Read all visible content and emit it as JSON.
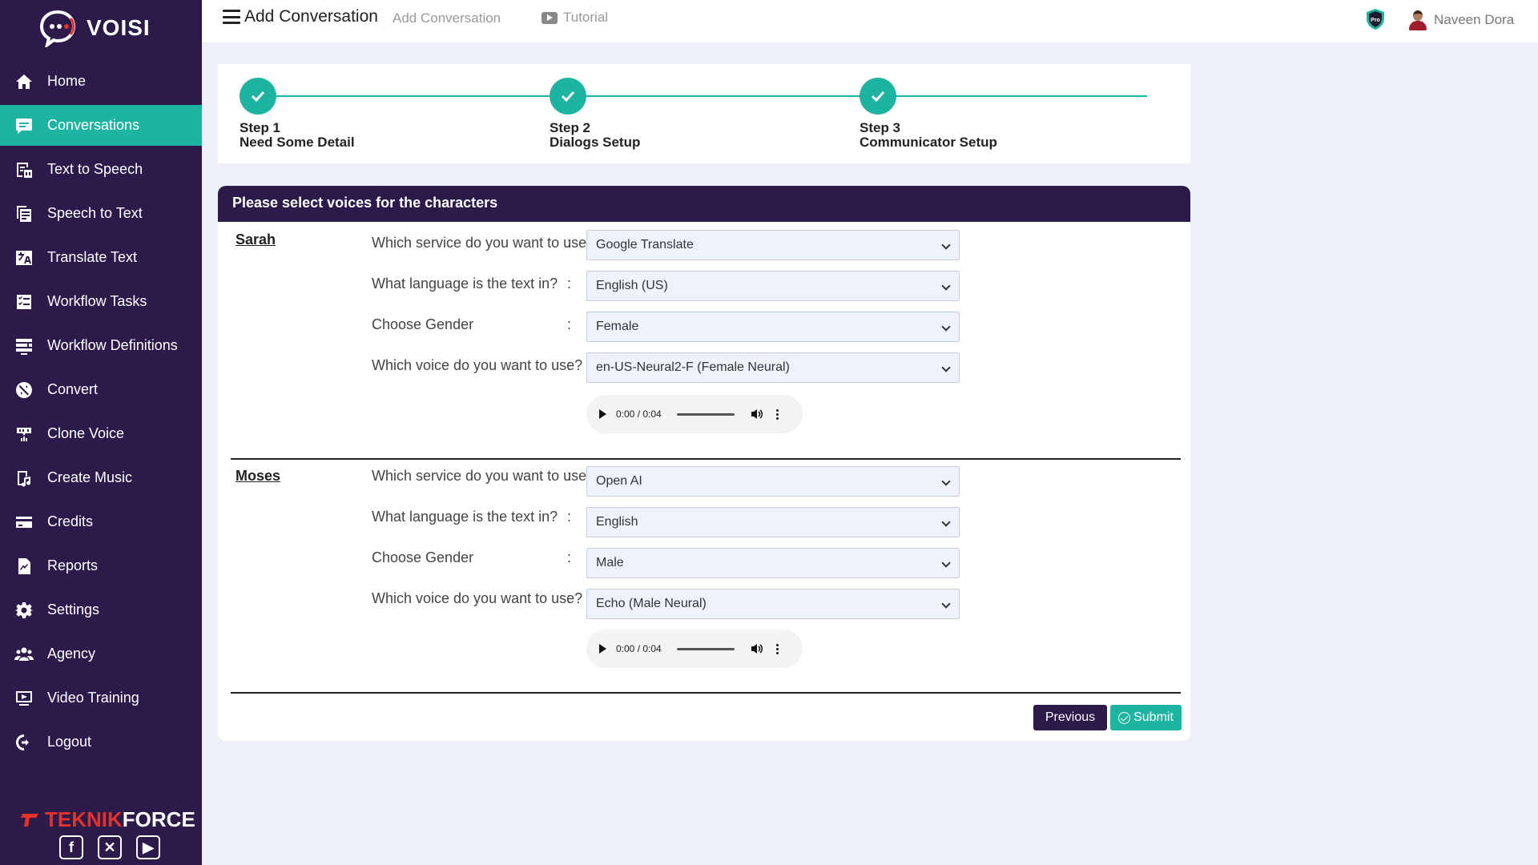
{
  "app": {
    "brand": "voisi",
    "footer_brand_a": "TEKNIK",
    "footer_brand_b": "FORCE"
  },
  "sidebar": {
    "items": [
      {
        "label": "Home",
        "icon": "home-icon",
        "active": false
      },
      {
        "label": "Conversations",
        "icon": "chat-icon",
        "active": true
      },
      {
        "label": "Text to Speech",
        "icon": "text-to-speech-icon",
        "active": false
      },
      {
        "label": "Speech to Text",
        "icon": "speech-to-text-icon",
        "active": false
      },
      {
        "label": "Translate Text",
        "icon": "translate-icon",
        "active": false
      },
      {
        "label": "Workflow Tasks",
        "icon": "tasks-icon",
        "active": false
      },
      {
        "label": "Workflow Definitions",
        "icon": "definitions-icon",
        "active": false
      },
      {
        "label": "Convert",
        "icon": "convert-icon",
        "active": false
      },
      {
        "label": "Clone Voice",
        "icon": "clone-voice-icon",
        "active": false
      },
      {
        "label": "Create Music",
        "icon": "music-icon",
        "active": false
      },
      {
        "label": "Credits",
        "icon": "credit-card-icon",
        "active": false
      },
      {
        "label": "Reports",
        "icon": "reports-icon",
        "active": false
      },
      {
        "label": "Settings",
        "icon": "gear-icon",
        "active": false
      },
      {
        "label": "Agency",
        "icon": "users-icon",
        "active": false
      },
      {
        "label": "Video Training",
        "icon": "video-icon",
        "active": false
      },
      {
        "label": "Logout",
        "icon": "logout-icon",
        "active": false
      }
    ],
    "socials": [
      "facebook-icon",
      "x-icon",
      "youtube-icon"
    ]
  },
  "header": {
    "title": "Add Conversation",
    "breadcrumb": "Add Conversation",
    "tutorial": "Tutorial",
    "pro_badge": "Pro",
    "user_name": "Naveen Dora"
  },
  "steps": [
    {
      "step": "Step 1",
      "name": "Need Some Detail"
    },
    {
      "step": "Step 2",
      "name": "Dialogs Setup"
    },
    {
      "step": "Step 3",
      "name": "Communicator Setup"
    }
  ],
  "panel": {
    "title": "Please select voices for the characters",
    "labels": {
      "service": "Which service do you want to use?",
      "language": "What language is the text in?",
      "gender": "Choose Gender",
      "voice": "Which voice do you want to use?"
    },
    "colon": ":",
    "characters": [
      {
        "name": "Sarah",
        "service": "Google Translate",
        "language": "English (US)",
        "gender": "Female",
        "voice": "en-US-Neural2-F (Female Neural)",
        "audio_time": "0:00 / 0:04"
      },
      {
        "name": "Moses",
        "service": "Open AI",
        "language": "English",
        "gender": "Male",
        "voice": "Echo (Male Neural)",
        "audio_time": "0:00 / 0:04"
      }
    ],
    "previous_label": "Previous",
    "submit_label": "Submit"
  },
  "colors": {
    "sidebar_bg": "#2b1a4a",
    "accent": "#1db4a2",
    "page_bg": "#eef2f8"
  }
}
